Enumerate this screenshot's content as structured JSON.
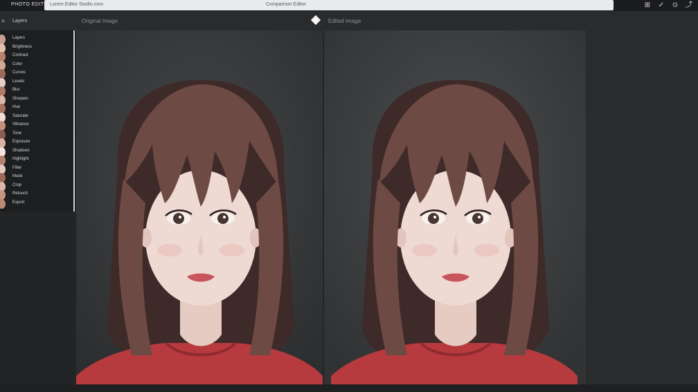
{
  "app": {
    "name": "PHOTO EDITOR",
    "address_left": "Lorem Editor Studio.com",
    "address_center": "Comparison Editor"
  },
  "toolbar_icons": [
    "crop-icon",
    "check-icon",
    "info-icon",
    "share-icon"
  ],
  "header": {
    "layers_label": "Layers",
    "left_title": "Original Image",
    "right_title": "Edited Image"
  },
  "sidebar": {
    "items": [
      {
        "label": "Layers",
        "color": "#c8a08e"
      },
      {
        "label": "Brightness",
        "color": "#e2c0b0"
      },
      {
        "label": "Contrast",
        "color": "#b9826d"
      },
      {
        "label": "Color",
        "color": "#d4a796"
      },
      {
        "label": "Curves",
        "color": "#9d6a5a"
      },
      {
        "label": "Levels",
        "color": "#e6cfc4"
      },
      {
        "label": "Blur",
        "color": "#b07a68"
      },
      {
        "label": "Sharpen",
        "color": "#dcb8a8"
      },
      {
        "label": "Hue",
        "color": "#a87362"
      },
      {
        "label": "Saturate",
        "color": "#f0ddd4"
      },
      {
        "label": "Vibrance",
        "color": "#c4907c"
      },
      {
        "label": "Tone",
        "color": "#8d5e50"
      },
      {
        "label": "Exposure",
        "color": "#d9b2a2"
      },
      {
        "label": "Shadows",
        "color": "#f4e6de"
      },
      {
        "label": "Highlight",
        "color": "#b58371"
      },
      {
        "label": "Filter",
        "color": "#e7cbbd"
      },
      {
        "label": "Mask",
        "color": "#a06a59"
      },
      {
        "label": "Crop",
        "color": "#ddb6a6"
      },
      {
        "label": "Retouch",
        "color": "#c79683"
      },
      {
        "label": "Export",
        "color": "#bb8876"
      }
    ]
  },
  "colors": {
    "hair": "#6e4a44",
    "hair_dark": "#3e2a28",
    "skin": "#eed9d3",
    "sweater": "#b73a3e",
    "lip": "#c8555e"
  }
}
